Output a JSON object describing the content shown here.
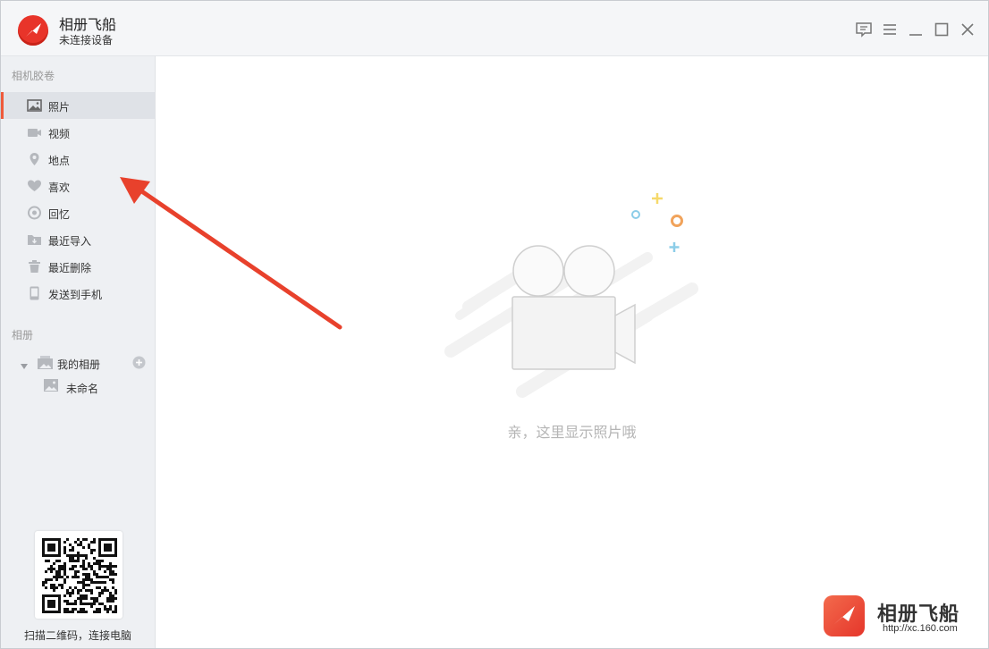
{
  "app": {
    "title": "相册飞船",
    "status": "未连接设备"
  },
  "sidebar": {
    "roll_title": "相机胶卷",
    "items": [
      {
        "label": "照片",
        "icon": "photo-icon",
        "active": true
      },
      {
        "label": "视频",
        "icon": "video-icon"
      },
      {
        "label": "地点",
        "icon": "location-pin-icon"
      },
      {
        "label": "喜欢",
        "icon": "heart-icon"
      },
      {
        "label": "回忆",
        "icon": "memory-icon"
      },
      {
        "label": "最近导入",
        "icon": "import-folder-icon"
      },
      {
        "label": "最近删除",
        "icon": "trash-icon"
      },
      {
        "label": "发送到手机",
        "icon": "phone-icon"
      }
    ],
    "albums_title": "相册",
    "my_albums": "我的相册",
    "album_child": "未命名",
    "qr_caption": "扫描二维码，连接电脑"
  },
  "main": {
    "empty_text": "亲，这里显示照片哦"
  },
  "brand": {
    "name": "相册飞船",
    "url": "http://xc.160.com"
  },
  "colors": {
    "accent": "#ef5a3a",
    "logo_red": "#e8342a",
    "sidebar_bg": "#eef0f3",
    "arrow": "#e8412c"
  }
}
